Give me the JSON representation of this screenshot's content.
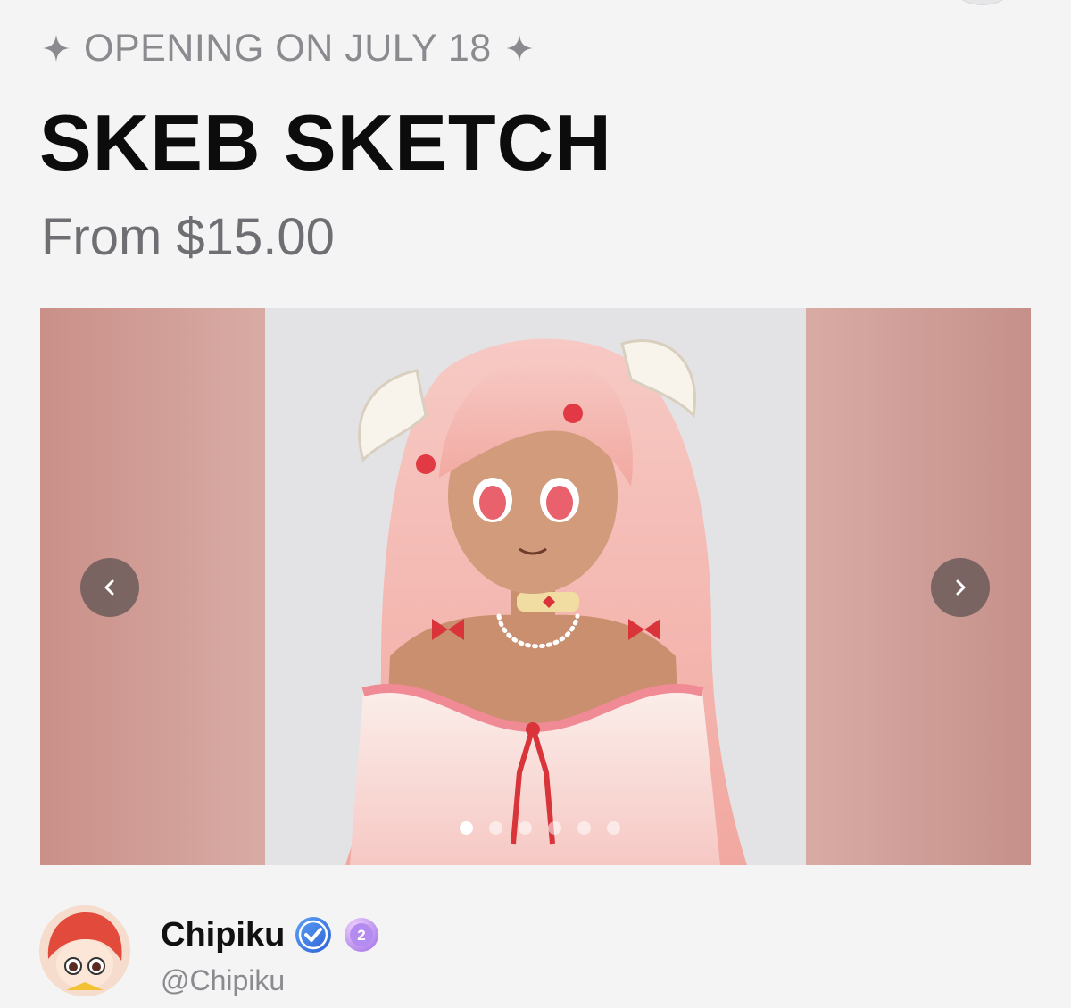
{
  "opening": {
    "text": "OPENING ON JULY 18",
    "left_icon": "sparkle-icon",
    "right_icon": "sparkle-icon"
  },
  "product": {
    "title": "SKEB SKETCH",
    "price": "From $15.00"
  },
  "carousel": {
    "prev_icon": "chevron-left-icon",
    "next_icon": "chevron-right-icon",
    "slide_count": 6,
    "active_slide": 1,
    "image_description_icon": "artwork-image"
  },
  "creator": {
    "name": "Chipiku",
    "handle": "@Chipiku",
    "verified_icon": "verified-check-icon",
    "level_badge": "2"
  },
  "colors": {
    "background": "#f4f4f5",
    "title": "#0c0c0d",
    "muted": "#8a8a8f",
    "verified": "#3d7be0",
    "level_badge": "#b18cf0"
  }
}
